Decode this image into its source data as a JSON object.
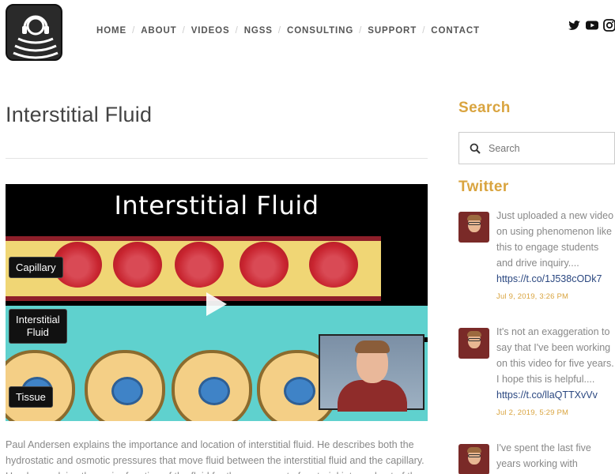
{
  "nav": {
    "items": [
      "HOME",
      "ABOUT",
      "VIDEOS",
      "NGSS",
      "CONSULTING",
      "SUPPORT",
      "CONTACT"
    ]
  },
  "social": [
    "twitter-icon",
    "youtube-icon",
    "instagram-icon"
  ],
  "main": {
    "title": "Interstitial Fluid",
    "video": {
      "title": "Interstitial Fluid",
      "labels": {
        "capillary": "Capillary",
        "interstitial": "Interstitial\nFluid",
        "tissue": "Tissue"
      }
    },
    "description": "Paul Andersen explains the importance and location of interstitial fluid. He describes both the hydrostatic and osmotic pressures that move fluid between the interstitial fluid and the capillary. He also explains the major function of the fluid for the movement of material into and out of the"
  },
  "sidebar": {
    "search_heading": "Search",
    "search_placeholder": "Search",
    "twitter_heading": "Twitter",
    "tweets": [
      {
        "text": "Just uploaded a new video on using phenomenon like this to engage students and drive inquiry....",
        "link": "https://t.co/1J538cODk7",
        "date": "Jul 9, 2019, 3:26 PM"
      },
      {
        "text": "It's not an exaggeration to say that I've been working on this video for five years. I hope this is helpful....",
        "link": "https://t.co/llaQTTXvVv",
        "date": "Jul 2, 2019, 5:29 PM"
      },
      {
        "text": "I've spent the last five years working with",
        "link": "",
        "date": ""
      }
    ]
  },
  "colors": {
    "accent": "#d9a43f",
    "link": "#2a4780"
  }
}
